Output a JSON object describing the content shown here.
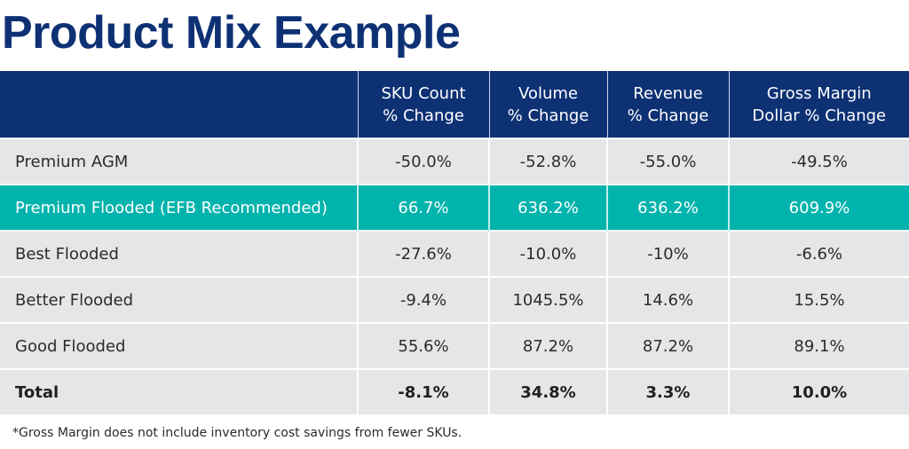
{
  "title": "Product Mix Example",
  "table": {
    "headers": [
      {
        "line1": "",
        "line2": ""
      },
      {
        "line1": "SKU Count",
        "line2": "% Change"
      },
      {
        "line1": "Volume",
        "line2": "% Change"
      },
      {
        "line1": "Revenue",
        "line2": "% Change"
      },
      {
        "line1": "Gross Margin",
        "line2": "Dollar % Change"
      }
    ],
    "rows": [
      {
        "label": "Premium AGM",
        "sku": "-50.0%",
        "volume": "-52.8%",
        "revenue": "-55.0%",
        "gross_margin": "-49.5%",
        "highlighted": false
      },
      {
        "label": "Premium Flooded (EFB Recommended)",
        "sku": "66.7%",
        "volume": "636.2%",
        "revenue": "636.2%",
        "gross_margin": "609.9%",
        "highlighted": true
      },
      {
        "label": "Best Flooded",
        "sku": "-27.6%",
        "volume": "-10.0%",
        "revenue": "-10%",
        "gross_margin": "-6.6%",
        "highlighted": false
      },
      {
        "label": "Better Flooded",
        "sku": "-9.4%",
        "volume": "1045.5%",
        "revenue": "14.6%",
        "gross_margin": "15.5%",
        "highlighted": false
      },
      {
        "label": "Good Flooded",
        "sku": "55.6%",
        "volume": "87.2%",
        "revenue": "87.2%",
        "gross_margin": "89.1%",
        "highlighted": false
      },
      {
        "label": "Total",
        "sku": "-8.1%",
        "volume": "34.8%",
        "revenue": "3.3%",
        "gross_margin": "10.0%",
        "highlighted": false
      }
    ]
  },
  "footnote": "*Gross Margin does not include inventory cost savings from fewer SKUs.",
  "colors": {
    "header_navy": "#0e3174",
    "highlight_teal": "#00b3ac",
    "row_gray": "#e6e6e8"
  }
}
